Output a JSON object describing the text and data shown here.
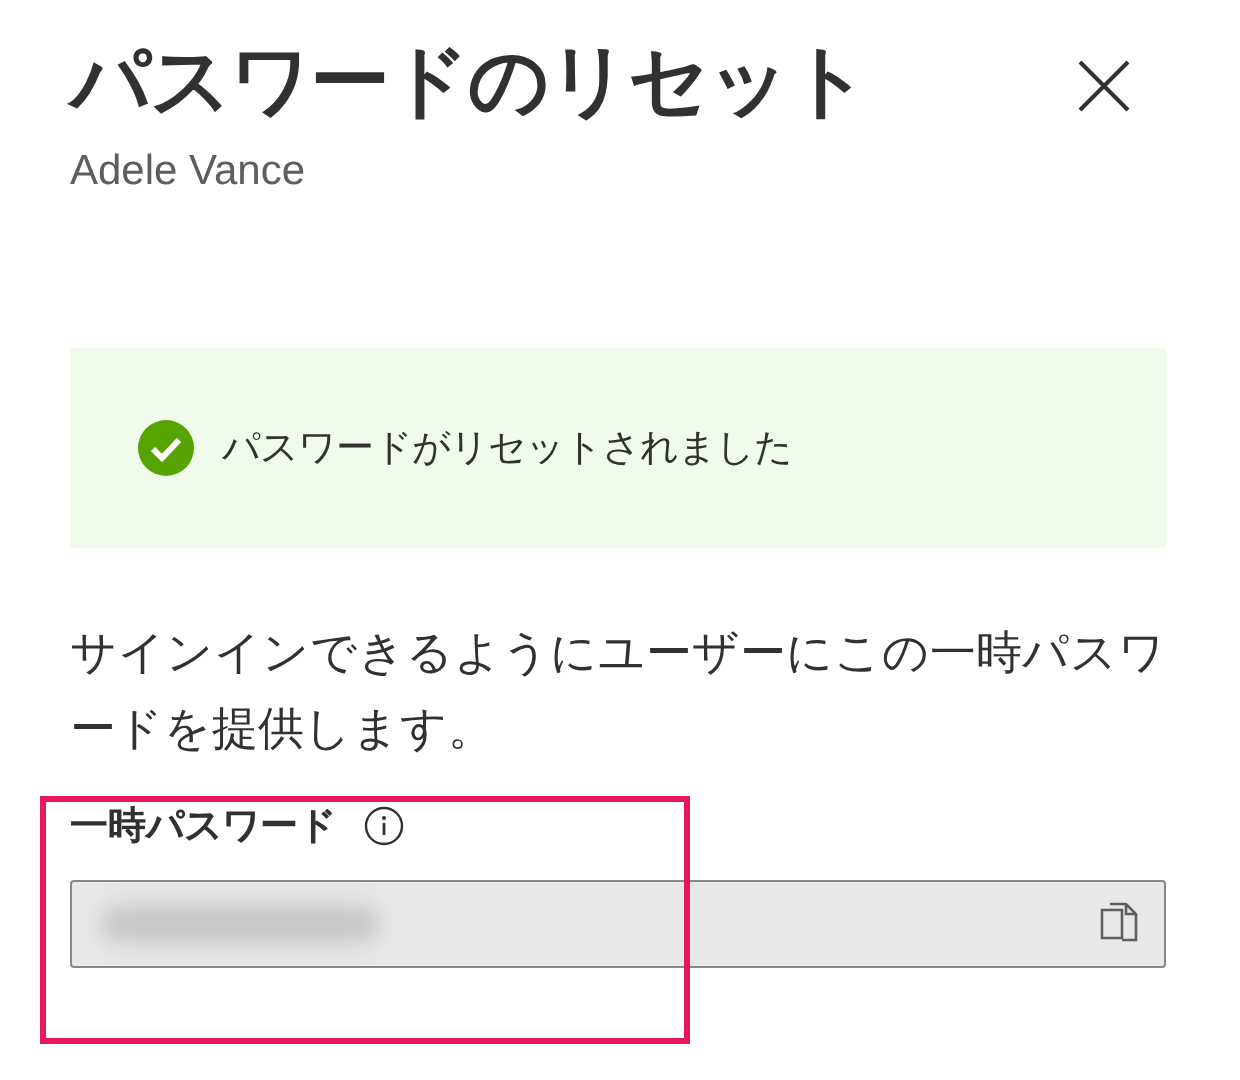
{
  "panel": {
    "title": "パスワードのリセット",
    "subtitle": "Adele Vance"
  },
  "banner": {
    "message": "パスワードがリセットされました",
    "kind": "success"
  },
  "description": "サインインできるようにユーザーにこの一時パスワードを提供します。",
  "field": {
    "label": "一時パスワード",
    "value_hidden": true
  },
  "highlight": {
    "shown": true,
    "color": "#e8175d"
  }
}
